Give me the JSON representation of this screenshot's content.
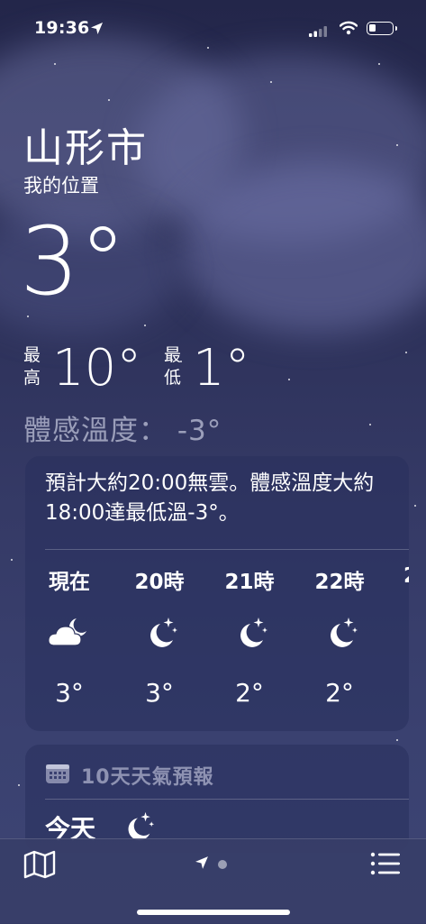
{
  "status_bar": {
    "time": "19:36"
  },
  "location": {
    "city": "山形市",
    "subtitle": "我的位置"
  },
  "current": {
    "temp": "3°",
    "high_label": "最高",
    "high": "10°",
    "low_label": "最低",
    "low": "1°",
    "feels_like": "體感溫度： -3°"
  },
  "hourly": {
    "description": "預計大約20:00無雲。體感溫度大約18:00達最低溫-3°。",
    "hours": [
      {
        "label": "現在",
        "icon": "partly-cloudy-night-icon",
        "temp": "3°"
      },
      {
        "label": "20時",
        "icon": "clear-night-icon",
        "temp": "3°"
      },
      {
        "label": "21時",
        "icon": "clear-night-icon",
        "temp": "2°"
      },
      {
        "label": "22時",
        "icon": "clear-night-icon",
        "temp": "2°"
      },
      {
        "label": "2",
        "icon": "",
        "temp": ""
      }
    ]
  },
  "ten_day": {
    "title": "10天天氣預報",
    "today_label": "今天",
    "today_icon": "clear-night-icon"
  },
  "tabbar": {
    "map_icon": "map-icon",
    "location_icon": "location-arrow-icon",
    "list_icon": "list-icon"
  },
  "colors": {
    "background_top": "#23264a",
    "background_bottom": "#3d4574",
    "card": "#28305c"
  }
}
